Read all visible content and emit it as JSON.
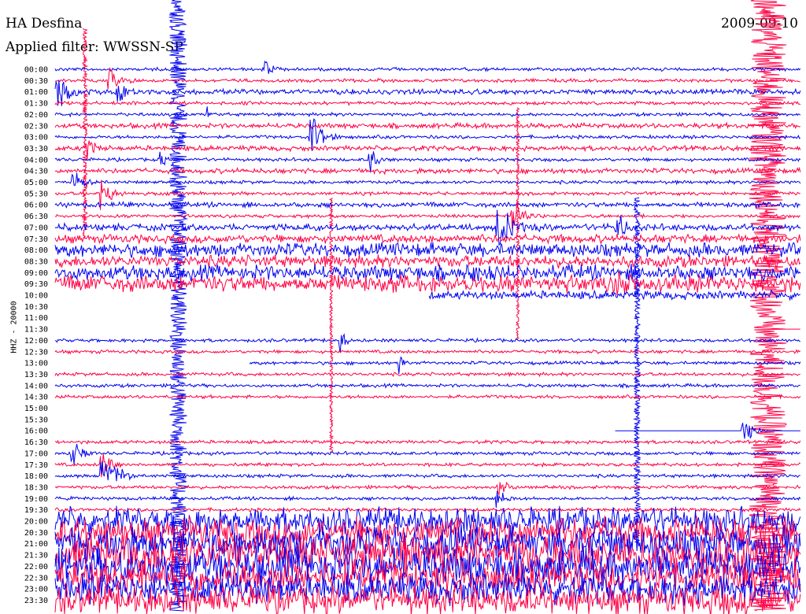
{
  "header": {
    "station": "HA Desfina",
    "filter": "Applied filter: WWSSN-SP",
    "date": "2009-09-10"
  },
  "chart_data": {
    "type": "line",
    "title": "HA Desfina",
    "ylabel": "HHZ - 20000",
    "ticks": [
      "00:00",
      "00:30",
      "01:00",
      "01:30",
      "02:00",
      "02:30",
      "03:00",
      "03:30",
      "04:00",
      "04:30",
      "05:00",
      "05:30",
      "06:00",
      "06:30",
      "07:00",
      "07:30",
      "08:00",
      "08:30",
      "09:00",
      "09:30",
      "10:00",
      "10:30",
      "11:00",
      "11:30",
      "12:00",
      "12:30",
      "13:00",
      "13:30",
      "14:00",
      "14:30",
      "15:00",
      "15:30",
      "16:00",
      "16:30",
      "17:00",
      "17:30",
      "18:00",
      "18:30",
      "19:00",
      "19:30",
      "20:00",
      "20:30",
      "21:00",
      "21:30",
      "22:00",
      "22:30",
      "23:00",
      "23:30"
    ],
    "colors": {
      "even": "#0000ee",
      "odd": "#ff0044"
    },
    "noise_level": [
      2,
      2,
      3,
      2,
      2,
      3,
      2,
      3,
      2,
      3,
      2,
      2,
      3,
      2,
      4,
      5,
      8,
      7,
      9,
      10,
      5,
      0,
      0,
      0,
      2,
      2,
      2,
      2,
      2,
      2,
      2,
      0,
      0,
      2,
      2,
      2,
      2,
      2,
      2,
      2,
      16,
      18,
      20,
      24,
      22,
      20,
      18,
      17
    ],
    "gaps": [
      {
        "row": 20,
        "start": 0.0,
        "end": 0.5
      },
      {
        "row": 21,
        "start": 0.0,
        "end": 1.0
      },
      {
        "row": 22,
        "start": 0.0,
        "end": 1.0
      },
      {
        "row": 23,
        "start": 0.0,
        "end": 0.96
      },
      {
        "row": 26,
        "start": 0.0,
        "end": 0.26
      },
      {
        "row": 30,
        "start": 0.0,
        "end": 1.0
      },
      {
        "row": 31,
        "start": 0.0,
        "end": 1.0
      },
      {
        "row": 32,
        "start": 0.0,
        "end": 0.75
      }
    ],
    "events": [
      {
        "row": 0,
        "x": 0.28,
        "amp": 22,
        "len": 0.03
      },
      {
        "row": 1,
        "x": 0.07,
        "amp": 25,
        "len": 0.05
      },
      {
        "row": 2,
        "x": 0.0,
        "amp": 40,
        "len": 0.05
      },
      {
        "row": 2,
        "x": 0.08,
        "amp": 28,
        "len": 0.04
      },
      {
        "row": 4,
        "x": 0.2,
        "amp": 20,
        "len": 0.02
      },
      {
        "row": 6,
        "x": 0.34,
        "amp": 40,
        "len": 0.05
      },
      {
        "row": 7,
        "x": 0.04,
        "amp": 25,
        "len": 0.04
      },
      {
        "row": 8,
        "x": 0.14,
        "amp": 20,
        "len": 0.02
      },
      {
        "row": 8,
        "x": 0.42,
        "amp": 25,
        "len": 0.03
      },
      {
        "row": 10,
        "x": 0.02,
        "amp": 30,
        "len": 0.04
      },
      {
        "row": 11,
        "x": 0.06,
        "amp": 28,
        "len": 0.05
      },
      {
        "row": 13,
        "x": 0.61,
        "amp": 35,
        "len": 0.05
      },
      {
        "row": 14,
        "x": 0.59,
        "amp": 45,
        "len": 0.06
      },
      {
        "row": 14,
        "x": 0.75,
        "amp": 40,
        "len": 0.03
      },
      {
        "row": 18,
        "x": 0.55,
        "amp": 25,
        "len": 0.08
      },
      {
        "row": 19,
        "x": 0.75,
        "amp": 30,
        "len": 0.08
      },
      {
        "row": 24,
        "x": 0.38,
        "amp": 35,
        "len": 0.02
      },
      {
        "row": 26,
        "x": 0.46,
        "amp": 20,
        "len": 0.02
      },
      {
        "row": 32,
        "x": 0.92,
        "amp": 25,
        "len": 0.04
      },
      {
        "row": 34,
        "x": 0.02,
        "amp": 25,
        "len": 0.05
      },
      {
        "row": 35,
        "x": 0.06,
        "amp": 30,
        "len": 0.05
      },
      {
        "row": 36,
        "x": 0.06,
        "amp": 45,
        "len": 0.06
      },
      {
        "row": 37,
        "x": 0.59,
        "amp": 25,
        "len": 0.04
      },
      {
        "row": 38,
        "x": 0.59,
        "amp": 20,
        "len": 0.04
      }
    ],
    "bursts": [
      {
        "x": 0.165,
        "width": 0.024,
        "rowStart": 0,
        "rowEnd": 48,
        "color": "#0000ee"
      },
      {
        "x": 0.955,
        "width": 0.05,
        "rowStart": 0,
        "rowEnd": 48,
        "color": "#ff0044"
      },
      {
        "x": 0.78,
        "width": 0.008,
        "rowStart": 18,
        "rowEnd": 42,
        "color": "#0000ee"
      },
      {
        "x": 0.62,
        "width": 0.004,
        "rowStart": 10,
        "rowEnd": 24,
        "color": "#ff0044"
      },
      {
        "x": 0.37,
        "width": 0.004,
        "rowStart": 18,
        "rowEnd": 34,
        "color": "#ff0044"
      },
      {
        "x": 0.04,
        "width": 0.006,
        "rowStart": 3,
        "rowEnd": 15,
        "color": "#ff0044"
      }
    ]
  }
}
